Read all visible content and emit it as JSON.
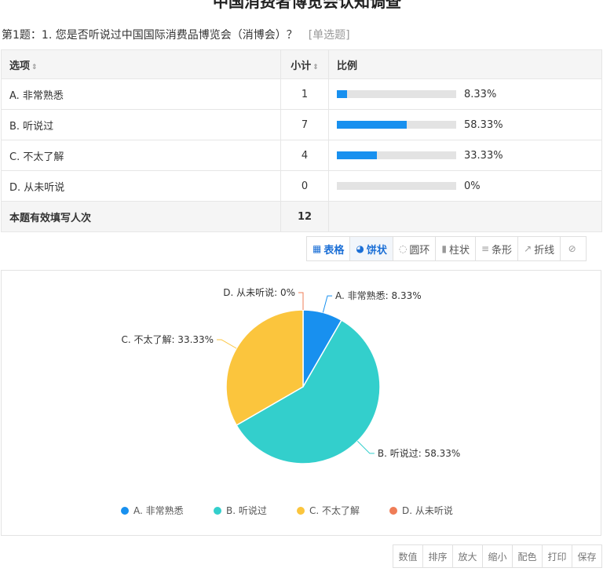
{
  "page": {
    "title": "中国消费者博览会认知调查",
    "question": "第1题：1. 您是否听说过中国国际消费品博览会（消博会）？",
    "question_type": "[单选题]"
  },
  "table": {
    "headers": {
      "option": "选项",
      "count": "小计",
      "ratio": "比例"
    },
    "sort_icon": "⇕",
    "rows": [
      {
        "option": "A. 非常熟悉",
        "count": "1",
        "ratio_label": "8.33%",
        "ratio": 0.0833
      },
      {
        "option": "B. 听说过",
        "count": "7",
        "ratio_label": "58.33%",
        "ratio": 0.5833
      },
      {
        "option": "C. 不太了解",
        "count": "4",
        "ratio_label": "33.33%",
        "ratio": 0.3333
      },
      {
        "option": "D. 从未听说",
        "count": "0",
        "ratio_label": "0%",
        "ratio": 0
      }
    ],
    "total": {
      "label": "本题有效填写人次",
      "count": "12"
    }
  },
  "toolbar": {
    "table": {
      "label": "表格",
      "icon": "table-icon"
    },
    "pie": {
      "label": "饼状",
      "icon": "pie-icon"
    },
    "ring": {
      "label": "圆环",
      "icon": "ring-icon"
    },
    "column": {
      "label": "柱状",
      "icon": "column-icon"
    },
    "bar": {
      "label": "条形",
      "icon": "bar-icon"
    },
    "line": {
      "label": "折线",
      "icon": "line-icon"
    },
    "hide": {
      "label": "",
      "icon": "hide-chart-icon"
    }
  },
  "bottom_toolbar": [
    "数值",
    "排序",
    "放大",
    "缩小",
    "配色",
    "打印",
    "保存"
  ],
  "colors": {
    "A": "#1890ef",
    "B": "#33cfcc",
    "C": "#fbc53d",
    "D": "#ef7d57",
    "bar_fill": "#1890ef",
    "active": "#1b6fd6"
  },
  "chart_data": {
    "type": "pie",
    "categories": [
      "A. 非常熟悉",
      "B. 听说过",
      "C. 不太了解",
      "D. 从未听说"
    ],
    "values": [
      8.33,
      58.33,
      33.33,
      0
    ],
    "labels": [
      "A. 非常熟悉: 8.33%",
      "B. 听说过: 58.33%",
      "C. 不太了解: 33.33%",
      "D. 从未听说: 0%"
    ],
    "legend": [
      "A. 非常熟悉",
      "B. 听说过",
      "C. 不太了解",
      "D. 从未听说"
    ],
    "legend_position": "bottom-center"
  }
}
